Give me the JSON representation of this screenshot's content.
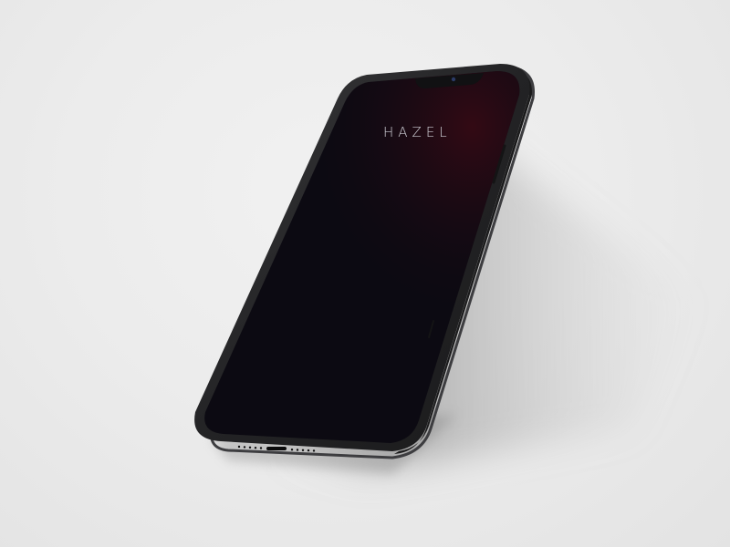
{
  "app": {
    "brand": "HAZEL"
  },
  "colors": {
    "background": "#ebebeb",
    "frame": "#2c2c2e",
    "screen": "#0e0a14",
    "screen_glow": "#3a0a14",
    "brand_text": "#cfcfd6"
  }
}
